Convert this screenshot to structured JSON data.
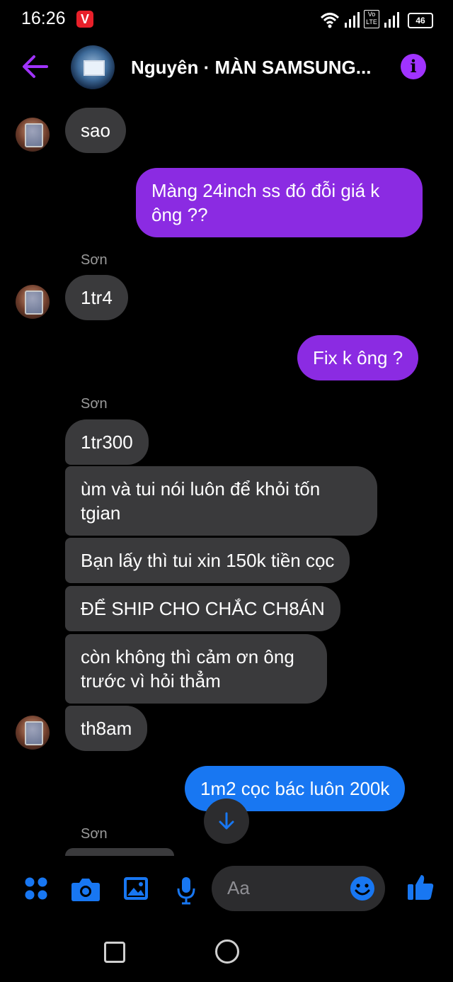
{
  "status": {
    "time": "16:26",
    "app_badge": "V",
    "volte": "Vo LTE",
    "battery": "46"
  },
  "header": {
    "title": "Nguyên · MÀN SAMSUNG...",
    "info_icon": "i"
  },
  "messages": [
    {
      "text": "sao"
    },
    {
      "text": "Màng 24inch ss đó đỗi giá k ông ??"
    },
    {
      "sender": "Sơn",
      "text": "1tr4"
    },
    {
      "text": "Fix k ông ?"
    },
    {
      "sender": "Sơn",
      "text": "1tr300"
    },
    {
      "text": "ùm và tui nói luôn để khỏi tốn tgian"
    },
    {
      "text": "Bạn lấy thì tui xin 150k tiền cọc"
    },
    {
      "text": "ĐỂ SHIP CHO CHẮC CH8ÁN"
    },
    {
      "text": "còn không thì cảm ơn ông trước vì hỏi thẳm"
    },
    {
      "text": "th8am"
    },
    {
      "text": "1m2 cọc bác luôn 200k"
    },
    {
      "sender": "Sơn"
    }
  ],
  "composer": {
    "placeholder": "Aa"
  },
  "colors": {
    "purple": "#8b2be2",
    "blue": "#1877f2",
    "incoming": "#3a3a3c",
    "accent": "#a033ff"
  }
}
